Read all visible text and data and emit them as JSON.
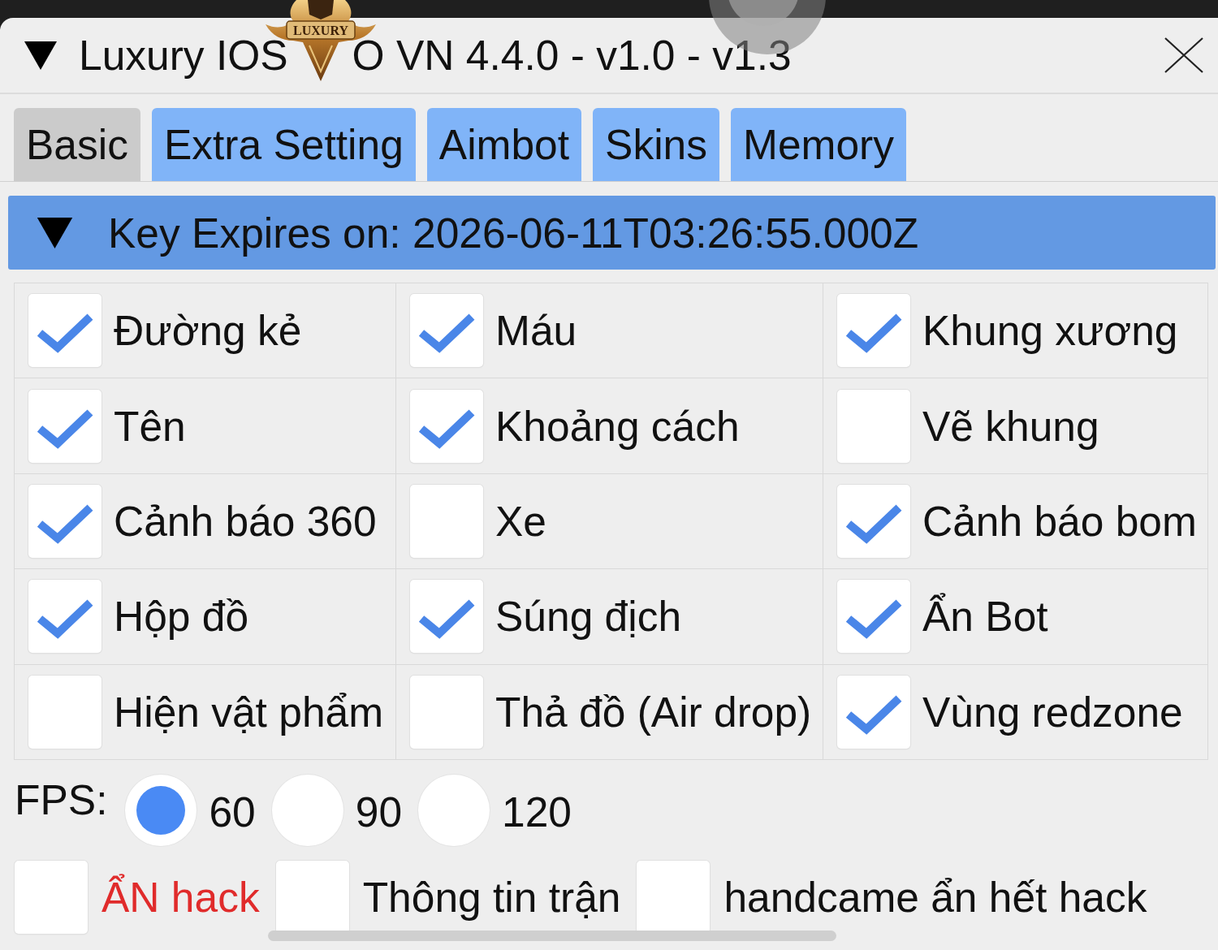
{
  "window": {
    "title_parts": [
      "Luxury IOS",
      "O VN 4.4.0 - v1.0 - v1.3"
    ],
    "expanded": true,
    "logo_text": "LUXURY"
  },
  "tabs": [
    {
      "label": "Basic",
      "selected": true
    },
    {
      "label": "Extra Setting",
      "selected": false
    },
    {
      "label": "Aimbot",
      "selected": false
    },
    {
      "label": "Skins",
      "selected": false
    },
    {
      "label": "Memory",
      "selected": false
    }
  ],
  "key_section": {
    "title": "Key Expires on: 2026-06-11T03:26:55.000Z",
    "expanded": true
  },
  "options": [
    {
      "label": "Đường kẻ",
      "checked": true
    },
    {
      "label": "Máu",
      "checked": true
    },
    {
      "label": "Khung xương",
      "checked": true
    },
    {
      "label": "Tên",
      "checked": true
    },
    {
      "label": "Khoảng cách",
      "checked": true
    },
    {
      "label": "Vẽ khung",
      "checked": false
    },
    {
      "label": "Cảnh báo 360",
      "checked": true
    },
    {
      "label": "Xe",
      "checked": false
    },
    {
      "label": "Cảnh báo bom",
      "checked": true
    },
    {
      "label": "Hộp đồ",
      "checked": true
    },
    {
      "label": "Súng địch",
      "checked": true
    },
    {
      "label": "Ẩn Bot",
      "checked": true
    },
    {
      "label": "Hiện vật phẩm",
      "checked": false
    },
    {
      "label": "Thả đồ (Air drop)",
      "checked": false
    },
    {
      "label": "Vùng redzone",
      "checked": true
    }
  ],
  "fps": {
    "label": "FPS:",
    "choices": [
      {
        "label": "60",
        "selected": true
      },
      {
        "label": "90",
        "selected": false
      },
      {
        "label": "120",
        "selected": false
      }
    ]
  },
  "toggles": [
    {
      "label": "ẨN hack",
      "checked": false,
      "color": "#e02b2b"
    },
    {
      "label": "Thông tin trận",
      "checked": false,
      "color": "#111111"
    },
    {
      "label": "handcame ẩn hết hack",
      "checked": false,
      "color": "#111111"
    }
  ]
}
